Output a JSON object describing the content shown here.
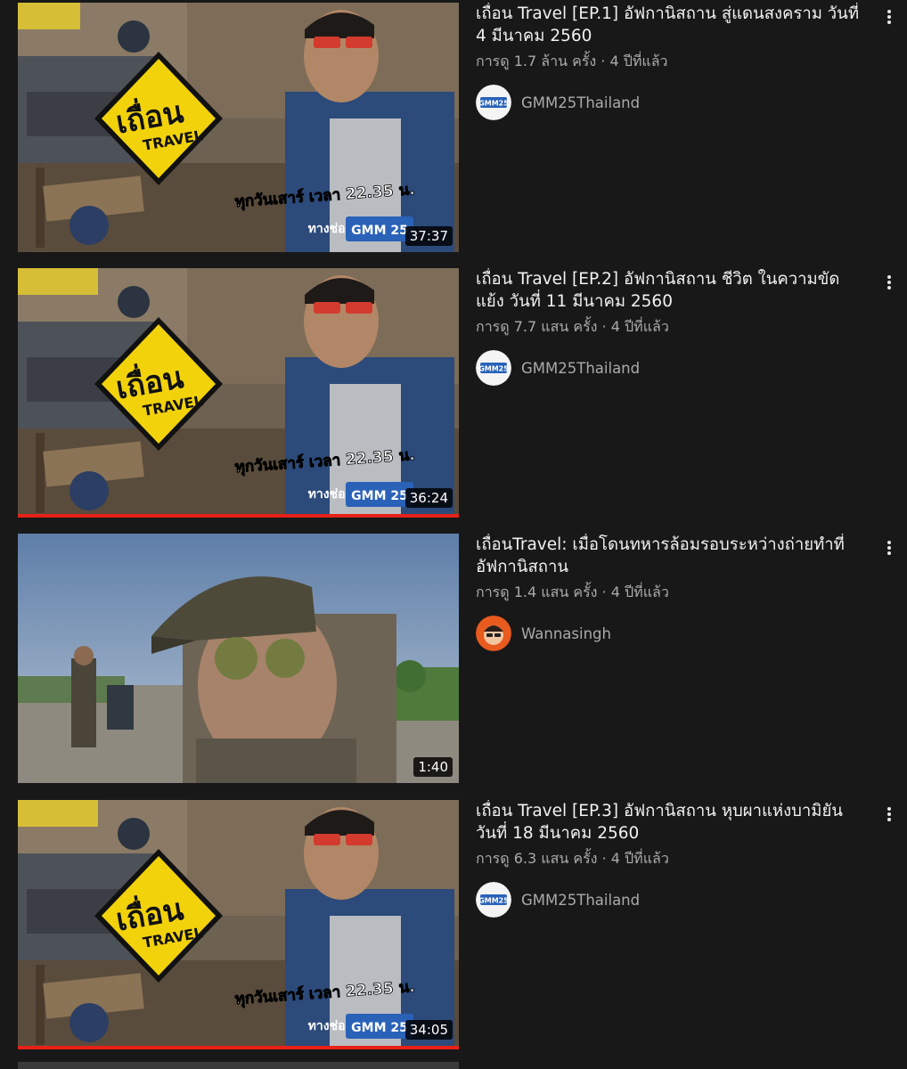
{
  "videos": [
    {
      "title": "เถื่อน Travel  [EP.1] อัฟกานิสถาน สู่แดนสงคราม  วันที่ 4 มีนาคม 2560",
      "stats": "การดู 1.7 ล้าน ครั้ง · 4 ปีที่แล้ว",
      "channel": "GMM25Thailand",
      "duration": "37:37",
      "thumb_text_time": "ทุกวันเสาร์ เวลา 22.35 น.",
      "thumb_text_channel": "ทางช่อง",
      "thumb_logo": "GMM 25",
      "watched_progress": 0
    },
    {
      "title": "เถื่อน Travel  [EP.2] อัฟกานิสถาน ชีวิต ในความขัดแย้ง  วันที่ 11 มีนาคม 2560",
      "stats": "การดู 7.7 แสน ครั้ง · 4 ปีที่แล้ว",
      "channel": "GMM25Thailand",
      "duration": "36:24",
      "thumb_text_time": "ทุกวันเสาร์ เวลา 22.35 น.",
      "thumb_text_channel": "ทางช่อง",
      "thumb_logo": "GMM 25",
      "watched_progress": 1
    },
    {
      "title": "เถื่อนTravel: เมื่อโดนทหารล้อมรอบระหว่างถ่ายทำที่อัฟกานิสถาน",
      "stats": "การดู 1.4 แสน ครั้ง · 4 ปีที่แล้ว",
      "channel": "Wannasingh",
      "duration": "1:40",
      "watched_progress": 0
    },
    {
      "title": "เถื่อน Travel  [EP.3] อัฟกานิสถาน หุบผาแห่งบามิยัน  วันที่ 18 มีนาคม 2560",
      "stats": "การดู 6.3 แสน ครั้ง · 4 ปีที่แล้ว",
      "channel": "GMM25Thailand",
      "duration": "34:05",
      "thumb_text_time": "ทุกวันเสาร์ เวลา 22.35 น.",
      "thumb_text_channel": "ทางช่อง",
      "thumb_logo": "GMM 25",
      "watched_progress": 1
    }
  ],
  "colors": {
    "background": "#181818",
    "progress": "#e62117",
    "secondary_text": "#aaaaaa",
    "sign_yellow": "#f2d20b"
  },
  "icons": {
    "more": "more-vert-icon"
  }
}
